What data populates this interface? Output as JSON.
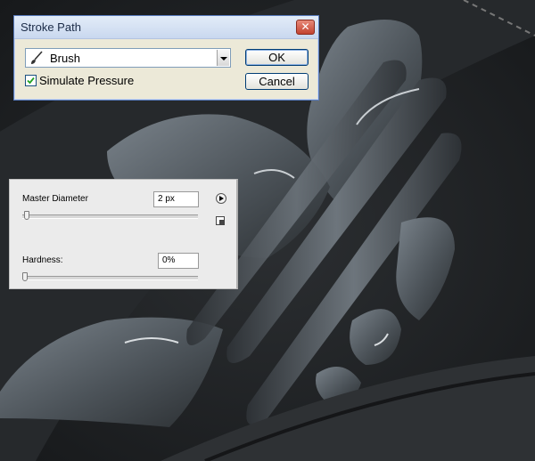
{
  "stroke_path_dialog": {
    "title": "Stroke Path",
    "tool_value": "Brush",
    "tool_icon": "brush-icon",
    "simulate_pressure_label": "Simulate Pressure",
    "simulate_pressure_checked": true,
    "ok_label": "OK",
    "cancel_label": "Cancel",
    "close_glyph": "✕"
  },
  "brush_panel": {
    "master_diameter_label": "Master Diameter",
    "master_diameter_value": "2 px",
    "hardness_label": "Hardness:",
    "hardness_value": "0%",
    "master_diameter_slider_level": 0.01,
    "hardness_slider_level": 0.0
  },
  "colors": {
    "canvas_dark": "#202224",
    "shape_light": "#8c959c",
    "dialog_bg": "#ece9d8",
    "panel_bg": "#ebebeb"
  }
}
